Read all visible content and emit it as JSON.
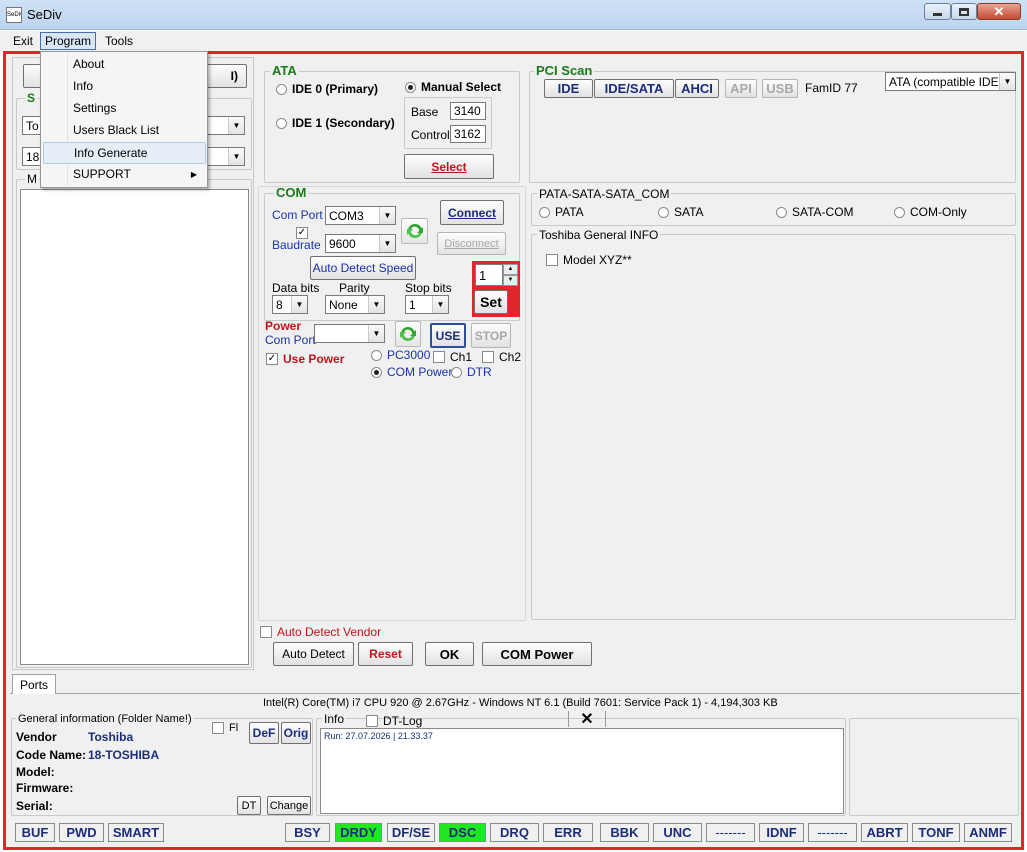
{
  "window": {
    "title": "SeDiv",
    "icon_text": "SeDiv"
  },
  "menubar": {
    "items": [
      "Exit",
      "Program",
      "Tools"
    ]
  },
  "program_menu": {
    "items": [
      "About",
      "Info",
      "Settings",
      "Users Black List",
      "Info Generate",
      "SUPPORT"
    ],
    "highlighted": "Info Generate"
  },
  "left": {
    "partial_btn_suffix": "I)",
    "group_label_partial": "S",
    "combo1": "To",
    "combo2": "18",
    "list_label_partial": "M"
  },
  "ata": {
    "title": "ATA",
    "ide0": "IDE 0 (Primary)",
    "ide1": "IDE 1 (Secondary)",
    "manual": "Manual Select",
    "base_label": "Base",
    "base_value": "3140",
    "control_label": "Control",
    "control_value": "3162",
    "select_btn": "Select"
  },
  "pci": {
    "title": "PCI Scan",
    "buttons": [
      "IDE",
      "IDE/SATA",
      "AHCI",
      "API",
      "USB"
    ],
    "famid": "FamID 77",
    "dropdown": "ATA (compatible IDE)"
  },
  "com": {
    "title": "COM",
    "com_port_label": "Com Port",
    "com_port_value": "COM3",
    "baudrate_label": "Baudrate",
    "baudrate_value": "9600",
    "connect": "Connect",
    "disconnect": "Disconnect",
    "auto_detect_speed": "Auto Detect Speed",
    "data_bits_label": "Data bits",
    "data_bits_value": "8",
    "parity_label": "Parity",
    "parity_value": "None",
    "stop_bits_label": "Stop bits",
    "stop_bits_value": "1",
    "spin_value": "1",
    "set_btn": "Set",
    "power_label": "Power",
    "power_com_port": "Com Port",
    "use_btn": "USE",
    "stop_btn": "STOP",
    "use_power": "Use Power",
    "pc3000": "PC3000",
    "ch1": "Ch1",
    "ch2": "Ch2",
    "com_power": "COM Power",
    "dtr": "DTR"
  },
  "pata": {
    "title": "PATA-SATA-SATA_COM",
    "options": [
      "PATA",
      "SATA",
      "SATA-COM",
      "COM-Only"
    ]
  },
  "toshiba": {
    "title": "Toshiba General INFO",
    "model": "Model XYZ**"
  },
  "bottom_actions": {
    "auto_detect_vendor": "Auto Detect Vendor",
    "auto_detect": "Auto Detect",
    "reset": "Reset",
    "ok": "OK",
    "com_power": "COM Power"
  },
  "tabs": {
    "ports": "Ports"
  },
  "sysinfo": "Intel(R) Core(TM) i7 CPU 920  @ 2.67GHz - Windows NT 6.1 (Build 7601: Service Pack 1) -  4,194,303 KB",
  "general": {
    "title": "General information (Folder Name!)",
    "fl": "Fl",
    "def": "DeF",
    "orig": "Orig",
    "vendor_label": "Vendor",
    "vendor_value": "Toshiba",
    "code_label": "Code Name:",
    "code_value": "18-TOSHIBA",
    "model_label": "Model:",
    "firmware_label": "Firmware:",
    "serial_label": "Serial:",
    "dt": "DT",
    "change": "Change"
  },
  "info": {
    "title": "Info",
    "dtlog": "DT-Log",
    "log": "Run: 27.07.2026 | 21.33.37"
  },
  "statusbar": [
    "BUF",
    "PWD",
    "SMART",
    "BSY",
    "DRDY",
    "DF/SE",
    "DSC",
    "DRQ",
    "ERR",
    "BBK",
    "UNC",
    "-------",
    "IDNF",
    "-------",
    "ABRT",
    "TONF",
    "ANMF"
  ],
  "colors": {
    "accent_green": "#22e622",
    "frame_red": "#e0262b",
    "label_blue": "#1a33a8",
    "label_red": "#c0141c"
  }
}
